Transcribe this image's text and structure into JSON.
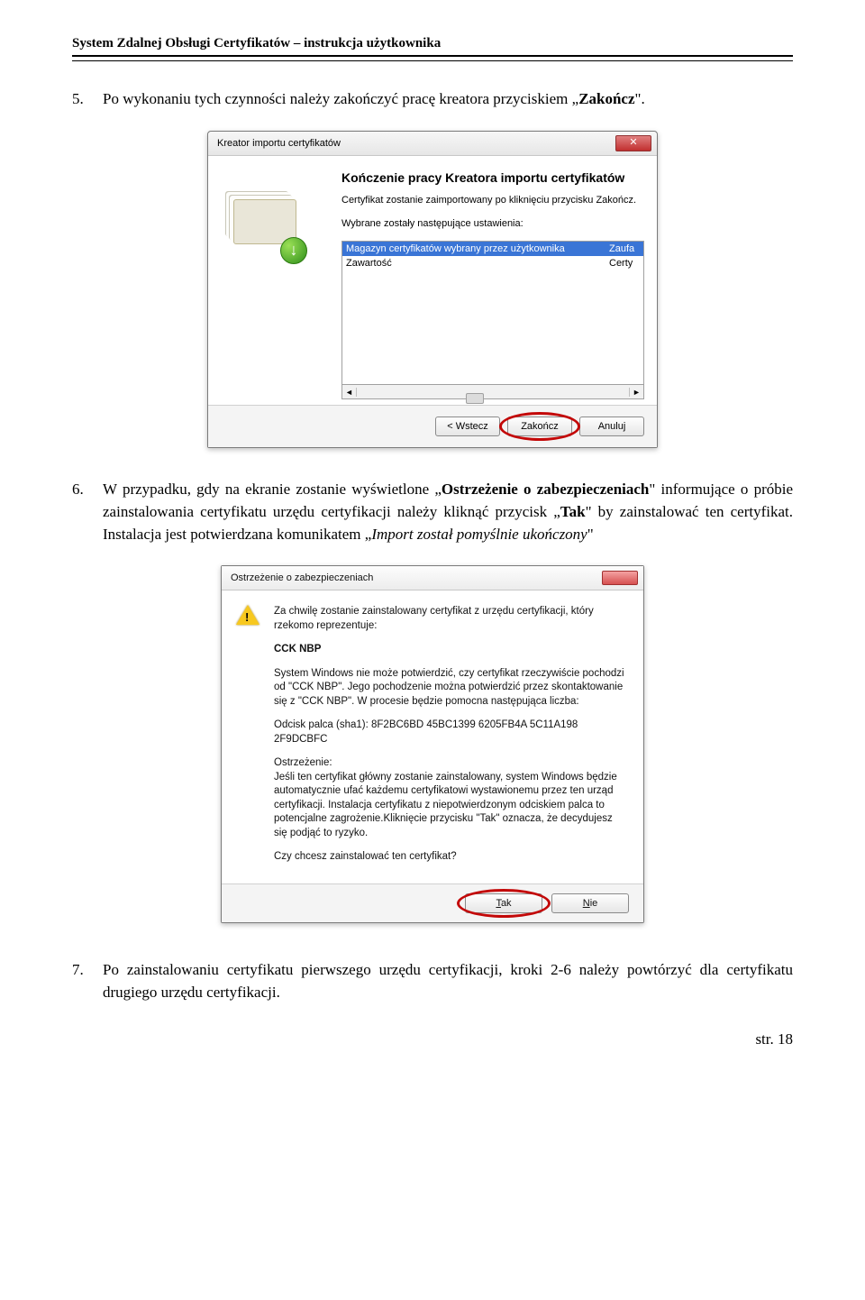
{
  "header": "System Zdalnej Obsługi Certyfikatów – instrukcja użytkownika",
  "step5": {
    "num": "5.",
    "t1": "Po wykonaniu tych czynności należy zakończyć pracę kreatora przyciskiem „",
    "b1": "Zakończ",
    "t2": "\"."
  },
  "dialog1": {
    "title": "Kreator importu certyfikatów",
    "heading": "Kończenie pracy Kreatora importu certyfikatów",
    "sub": "Certyfikat zostanie zaimportowany po kliknięciu przycisku Zakończ.",
    "listlabel": "Wybrane zostały następujące ustawienia:",
    "row1c1": "Magazyn certyfikatów wybrany przez użytkownika",
    "row1c2": "Zaufa",
    "row2c1": "Zawartość",
    "row2c2": "Certy",
    "btn_back": "< Wstecz",
    "btn_finish": "Zakończ",
    "btn_cancel": "Anuluj"
  },
  "step6": {
    "num": "6.",
    "t1": "W przypadku, gdy na ekranie zostanie wyświetlone „",
    "b1": "Ostrzeżenie o zabezpieczeniach",
    "t2": "\" informujące o próbie zainstalowania certyfikatu urzędu certyfikacji należy kliknąć przycisk „",
    "b2": "Tak",
    "t3": "\" by zainstalować ten certyfikat. Instalacja jest potwierdzana komunikatem „",
    "i1": "Import został pomyślnie ukończony",
    "t4": "\""
  },
  "dialog2": {
    "title": "Ostrzeżenie o zabezpieczeniach",
    "p1": "Za chwilę zostanie zainstalowany certyfikat z urzędu certyfikacji, który rzekomo reprezentuje:",
    "p2": "CCK NBP",
    "p3": "System Windows nie może potwierdzić, czy certyfikat rzeczywiście pochodzi od \"CCK NBP\". Jego pochodzenie można potwierdzić przez skontaktowanie się z \"CCK NBP\". W procesie będzie pomocna następująca liczba:",
    "p4": "Odcisk palca (sha1): 8F2BC6BD 45BC1399 6205FB4A 5C11A198 2F9DCBFC",
    "p5a": "Ostrzeżenie:",
    "p5b": "Jeśli ten certyfikat główny zostanie zainstalowany, system Windows będzie automatycznie ufać każdemu certyfikatowi wystawionemu przez ten urząd certyfikacji. Instalacja certyfikatu z niepotwierdzonym odciskiem palca to potencjalne zagrożenie.Kliknięcie przycisku \"Tak\" oznacza, że decydujesz się podjąć to ryzyko.",
    "p6": "Czy chcesz zainstalować ten certyfikat?",
    "btn_yes": "Tak",
    "btn_no": "Nie"
  },
  "step7": {
    "num": "7.",
    "text": "Po zainstalowaniu certyfikatu pierwszego urzędu certyfikacji, kroki 2-6 należy powtórzyć dla certyfikatu drugiego urzędu certyfikacji."
  },
  "page_number": "str. 18"
}
